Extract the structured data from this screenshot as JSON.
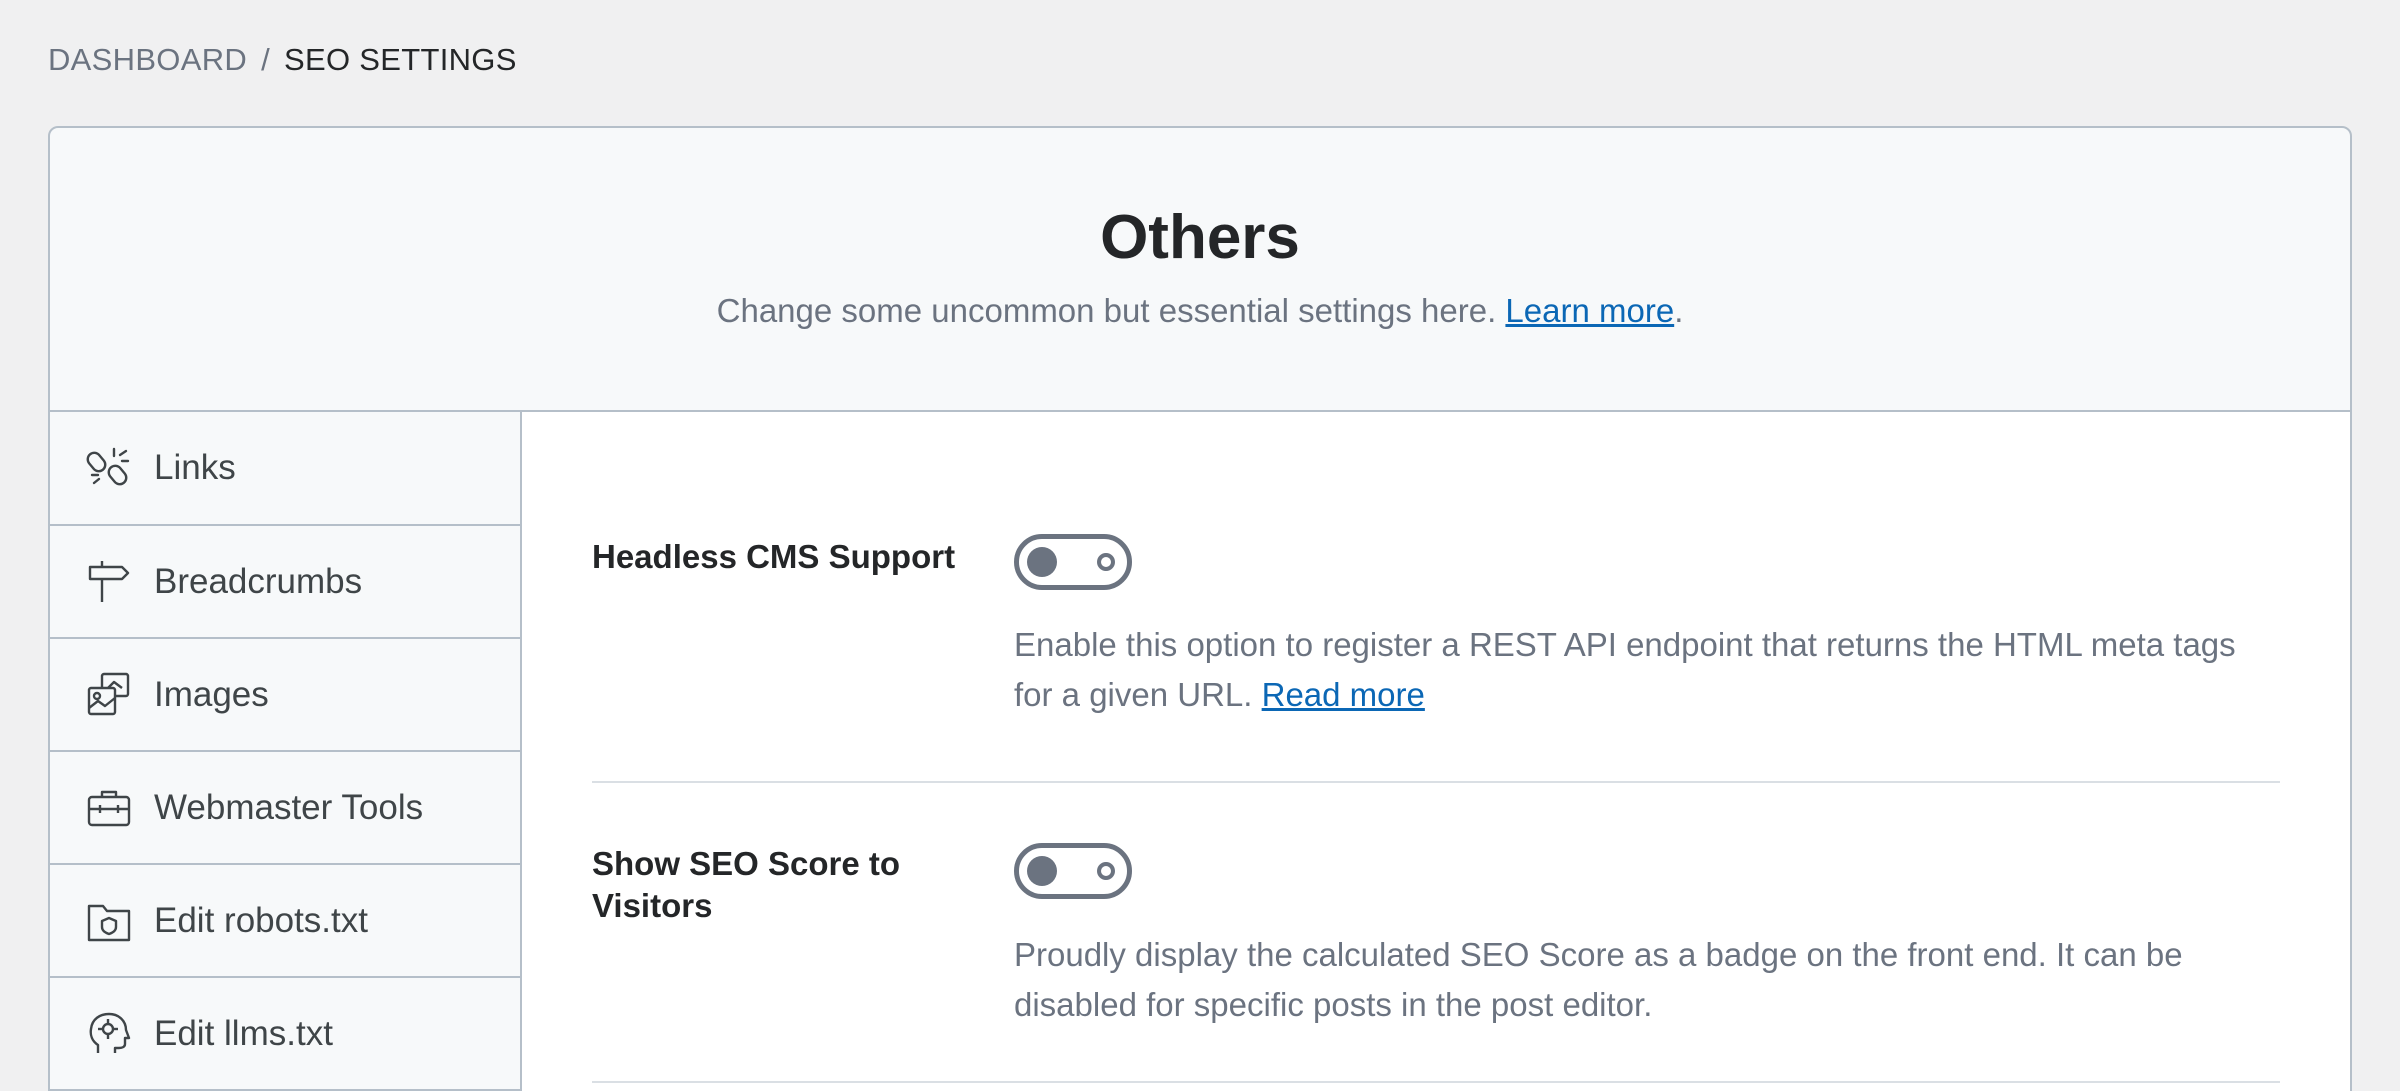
{
  "breadcrumb": {
    "parent": "DASHBOARD",
    "separator": "/",
    "current": "SEO SETTINGS"
  },
  "header": {
    "title": "Others",
    "description": "Change some uncommon but essential settings here.",
    "learn_more": "Learn more",
    "period": "."
  },
  "sidebar": {
    "items": [
      {
        "label": "Links",
        "icon": "link-icon"
      },
      {
        "label": "Breadcrumbs",
        "icon": "signpost-icon"
      },
      {
        "label": "Images",
        "icon": "images-icon"
      },
      {
        "label": "Webmaster Tools",
        "icon": "toolbox-icon"
      },
      {
        "label": "Edit robots.txt",
        "icon": "shield-file-icon"
      },
      {
        "label": "Edit llms.txt",
        "icon": "ai-head-icon"
      }
    ]
  },
  "settings": [
    {
      "label": "Headless CMS Support",
      "enabled": false,
      "description": "Enable this option to register a REST API endpoint that returns the HTML meta tags for a given URL.",
      "link": "Read more"
    },
    {
      "label": "Show SEO Score to Visitors",
      "enabled": false,
      "description": "Proudly display the calculated SEO Score as a badge on the front end. It can be disabled for specific posts in the post editor."
    }
  ],
  "colors": {
    "accent_link": "#0b67b5",
    "muted_text": "#6b7380",
    "border": "#b5bfc9"
  }
}
